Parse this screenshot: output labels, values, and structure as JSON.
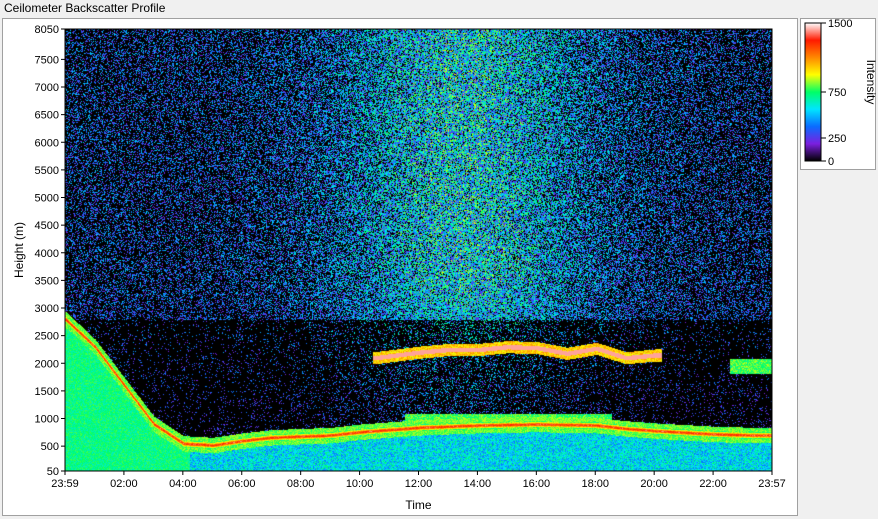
{
  "window": {
    "title": "Ceilometer Backscatter Profile"
  },
  "chart_data": {
    "type": "heatmap",
    "title": "Ceilometer Backscatter Profile",
    "xlabel": "Time",
    "ylabel": "Height (m)",
    "x_ticks": [
      "23:59",
      "02:00",
      "04:00",
      "06:00",
      "08:00",
      "10:00",
      "12:00",
      "14:00",
      "16:00",
      "18:00",
      "20:00",
      "22:00",
      "23:57"
    ],
    "y_ticks": [
      50,
      500,
      1000,
      1500,
      2000,
      2500,
      3000,
      3500,
      4000,
      4500,
      5000,
      5500,
      6000,
      6500,
      7000,
      7500,
      8050
    ],
    "ylim": [
      50,
      8050
    ],
    "xlim_hours": [
      -0.017,
      23.95
    ],
    "colorbar": {
      "label": "Intensity",
      "ticks": [
        0,
        250,
        750,
        1500
      ],
      "range": [
        0,
        1500
      ],
      "colors": [
        "#000000",
        "#7b1fe0",
        "#0a6cff",
        "#00e5ff",
        "#00ff66",
        "#ffff00",
        "#ff8800",
        "#ff1a00",
        "#ffffff"
      ]
    },
    "features": [
      {
        "name": "boundary layer",
        "points": [
          [
            0,
            2800
          ],
          [
            1,
            2300
          ],
          [
            2,
            1600
          ],
          [
            3,
            900
          ],
          [
            4,
            550
          ],
          [
            5,
            520
          ],
          [
            6,
            600
          ],
          [
            7,
            660
          ],
          [
            8,
            680
          ],
          [
            9,
            700
          ],
          [
            10,
            760
          ],
          [
            11,
            800
          ],
          [
            12,
            840
          ],
          [
            14,
            880
          ],
          [
            16,
            900
          ],
          [
            18,
            880
          ],
          [
            19,
            820
          ],
          [
            20,
            780
          ],
          [
            22,
            720
          ],
          [
            23.4,
            700
          ]
        ]
      },
      {
        "name": "cloud layer",
        "points": [
          [
            10.5,
            2100
          ],
          [
            12,
            2200
          ],
          [
            13,
            2250
          ],
          [
            14,
            2250
          ],
          [
            15,
            2300
          ],
          [
            16,
            2280
          ],
          [
            17,
            2180
          ],
          [
            18,
            2270
          ],
          [
            19,
            2100
          ],
          [
            20,
            2150
          ]
        ]
      }
    ]
  }
}
